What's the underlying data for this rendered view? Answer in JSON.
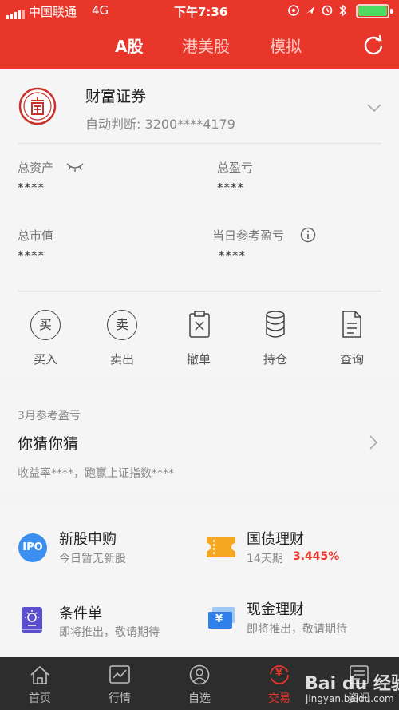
{
  "status_bar": {
    "carrier": "中国联通",
    "network": "4G",
    "time": "下午7:36"
  },
  "header": {
    "tabs": [
      {
        "label": "A股",
        "active": true
      },
      {
        "label": "港美股",
        "active": false
      },
      {
        "label": "模拟",
        "active": false
      }
    ],
    "refresh_icon": "refresh-icon",
    "accent_color": "#e8362b"
  },
  "account": {
    "broker_name": "财富证券",
    "account_line": "自动判断: 3200****4179"
  },
  "summary": {
    "total_assets_label": "总资产",
    "total_assets_value": "****",
    "total_pl_label": "总盈亏",
    "total_pl_value": "****",
    "market_value_label": "总市值",
    "market_value_value": "****",
    "daily_pl_label": "当日参考盈亏",
    "daily_pl_value": "****"
  },
  "actions": [
    {
      "label": "买入",
      "icon_char": "买"
    },
    {
      "label": "卖出",
      "icon_char": "卖"
    },
    {
      "label": "撤单"
    },
    {
      "label": "持仓"
    },
    {
      "label": "查询"
    }
  ],
  "monthly": {
    "header": "3月参考盈亏",
    "title": "你猜你猜",
    "desc": "收益率****，跑赢上证指数****"
  },
  "services": [
    {
      "title": "新股申购",
      "sub": "今日暂无新股",
      "icon_text": "IPO"
    },
    {
      "title": "国债理财",
      "sub": "14天期",
      "rate": "3.445%"
    },
    {
      "title": "条件单",
      "sub": "即将推出，敬请期待"
    },
    {
      "title": "现金理财",
      "sub": "即将推出，敬请期待",
      "icon_text": "¥"
    }
  ],
  "tabbar": {
    "items": [
      {
        "label": "首页",
        "active": false
      },
      {
        "label": "行情",
        "active": false
      },
      {
        "label": "自选",
        "active": false
      },
      {
        "label": "交易",
        "active": true,
        "icon_text": "¥"
      },
      {
        "label": "资讯",
        "active": false
      }
    ]
  },
  "watermark": {
    "text": "Bai du 经验",
    "url": "jingyan.baidu.com"
  }
}
